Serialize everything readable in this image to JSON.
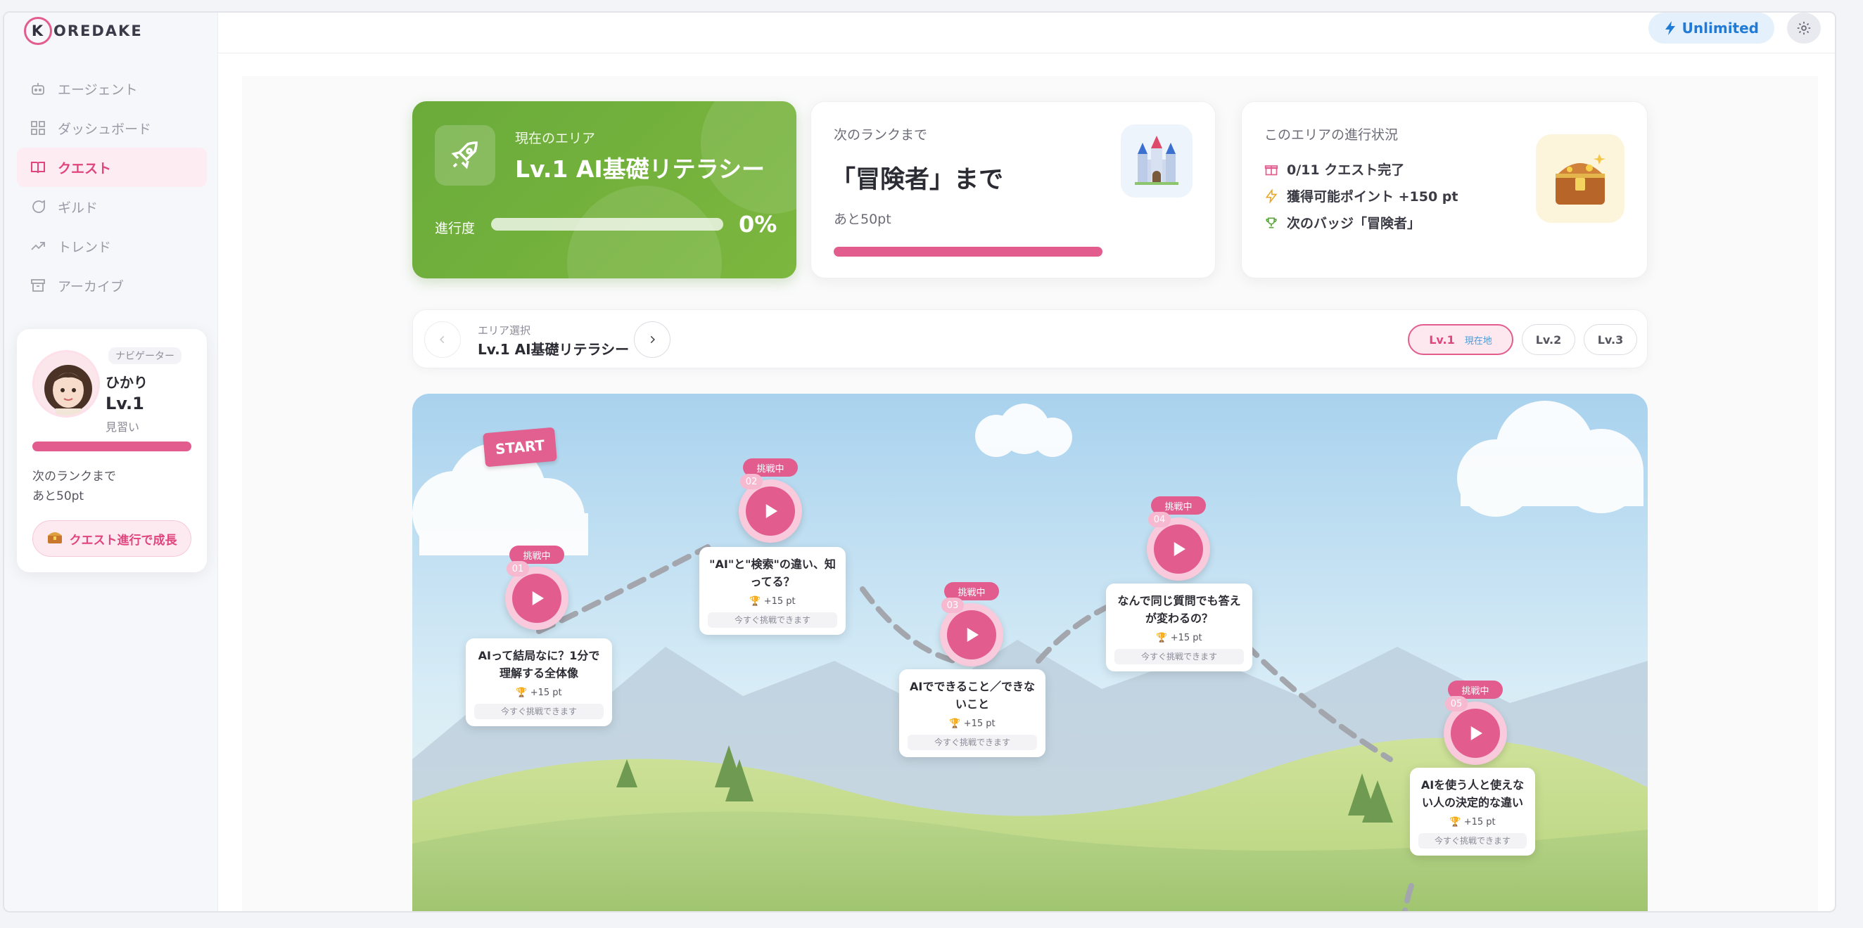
{
  "app": {
    "logo": "OREDAKE",
    "logo_initial": "K"
  },
  "sidebar": {
    "items": [
      {
        "label": "エージェント",
        "icon": "robot-icon"
      },
      {
        "label": "ダッシュボード",
        "icon": "dashboard-icon"
      },
      {
        "label": "クエスト",
        "icon": "book-icon",
        "active": true
      },
      {
        "label": "ギルド",
        "icon": "chat-icon"
      },
      {
        "label": "トレンド",
        "icon": "trend-icon"
      },
      {
        "label": "アーカイブ",
        "icon": "archive-icon"
      }
    ],
    "navigator": {
      "tag": "ナビゲーター",
      "name": "ひかり",
      "level": "Lv.1",
      "rank": "見習い",
      "next_line1": "次のランクまで",
      "next_line2": "あと50pt",
      "button": "クエスト進行で成長"
    }
  },
  "topbar": {
    "plan": "Unlimited"
  },
  "current_area": {
    "label": "現在のエリア",
    "title": "Lv.1 AI基礎リテラシー",
    "progress_label": "進行度",
    "progress_text": "0%",
    "progress": 0
  },
  "next_rank": {
    "label": "次のランクまで",
    "title": "「冒険者」まで",
    "sub": "あと50pt"
  },
  "area_progress": {
    "label": "このエリアの進行状況",
    "rows": [
      {
        "icon": "gift-icon",
        "text": "0/11 クエスト完了"
      },
      {
        "icon": "lightning-icon",
        "text": "獲得可能ポイント +150 pt"
      },
      {
        "icon": "trophy-icon",
        "text": "次のバッジ「冒険者」"
      }
    ]
  },
  "area_select": {
    "label": "エリア選択",
    "value": "Lv.1 AI基礎リテラシー",
    "levels": [
      {
        "label": "Lv.1",
        "here": "現在地"
      },
      {
        "label": "Lv.2"
      },
      {
        "label": "Lv.3"
      }
    ]
  },
  "map": {
    "start": "START",
    "quests": [
      {
        "num": "01",
        "status": "挑戦中",
        "title": "AIって結局なに？1分で理解する全体像",
        "points": "+15 pt",
        "state": "今すぐ挑戦できます"
      },
      {
        "num": "02",
        "status": "挑戦中",
        "title": "\"AI\"と\"検索\"の違い、知ってる？",
        "points": "+15 pt",
        "state": "今すぐ挑戦できます"
      },
      {
        "num": "03",
        "status": "挑戦中",
        "title": "AIでできること／できないこと",
        "points": "+15 pt",
        "state": "今すぐ挑戦できます"
      },
      {
        "num": "04",
        "status": "挑戦中",
        "title": "なんで同じ質問でも答えが変わるの？",
        "points": "+15 pt",
        "state": "今すぐ挑戦できます"
      },
      {
        "num": "05",
        "status": "挑戦中",
        "title": "AIを使う人と使えない人の決定的な違い",
        "points": "+15 pt",
        "state": "今すぐ挑戦できます"
      }
    ]
  },
  "colors": {
    "accent": "#e25c8e",
    "green": "#6aab3a",
    "blue": "#1f7ad8"
  }
}
